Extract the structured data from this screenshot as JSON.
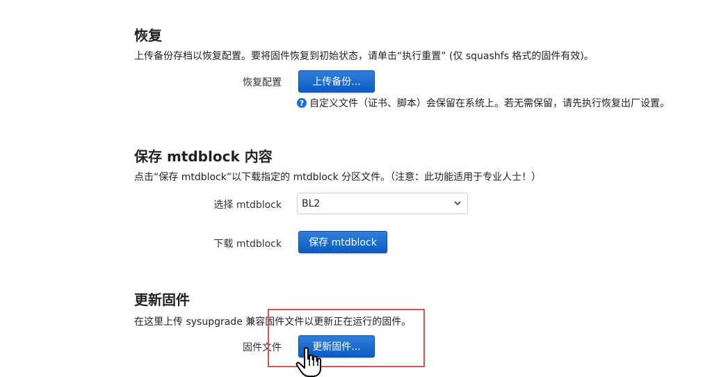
{
  "restore": {
    "title": "恢复",
    "description": "上传备份存档以恢复配置。要将固件恢复到初始状态，请单击“执行重置” (仅 squashfs 格式的固件有效)。",
    "row_label": "恢复配置",
    "button_label": "上传备份...",
    "hint": "自定义文件（证书、脚本）会保留在系统上。若无需保留，请先执行恢复出厂设置。"
  },
  "mtdblock": {
    "title": "保存 mtdblock 内容",
    "description": "点击“保存 mtdblock”以下载指定的 mtdblock 分区文件。（注意：此功能适用于专业人士！）",
    "select_label": "选择 mtdblock",
    "select_value": "BL2",
    "download_label": "下载 mtdblock",
    "button_label": "保存 mtdblock"
  },
  "firmware": {
    "title": "更新固件",
    "description": "在这里上传 sysupgrade 兼容固件文件以更新正在运行的固件。",
    "row_label": "固件文件",
    "button_label": "更新固件..."
  },
  "colors": {
    "button": "#0b5cc4",
    "highlight": "#e05252",
    "help_icon": "#1b6fd1"
  },
  "icons": {
    "help": "question-circle-icon",
    "dropdown": "chevron-down-icon",
    "cursor": "hand-pointer-cursor-icon"
  }
}
